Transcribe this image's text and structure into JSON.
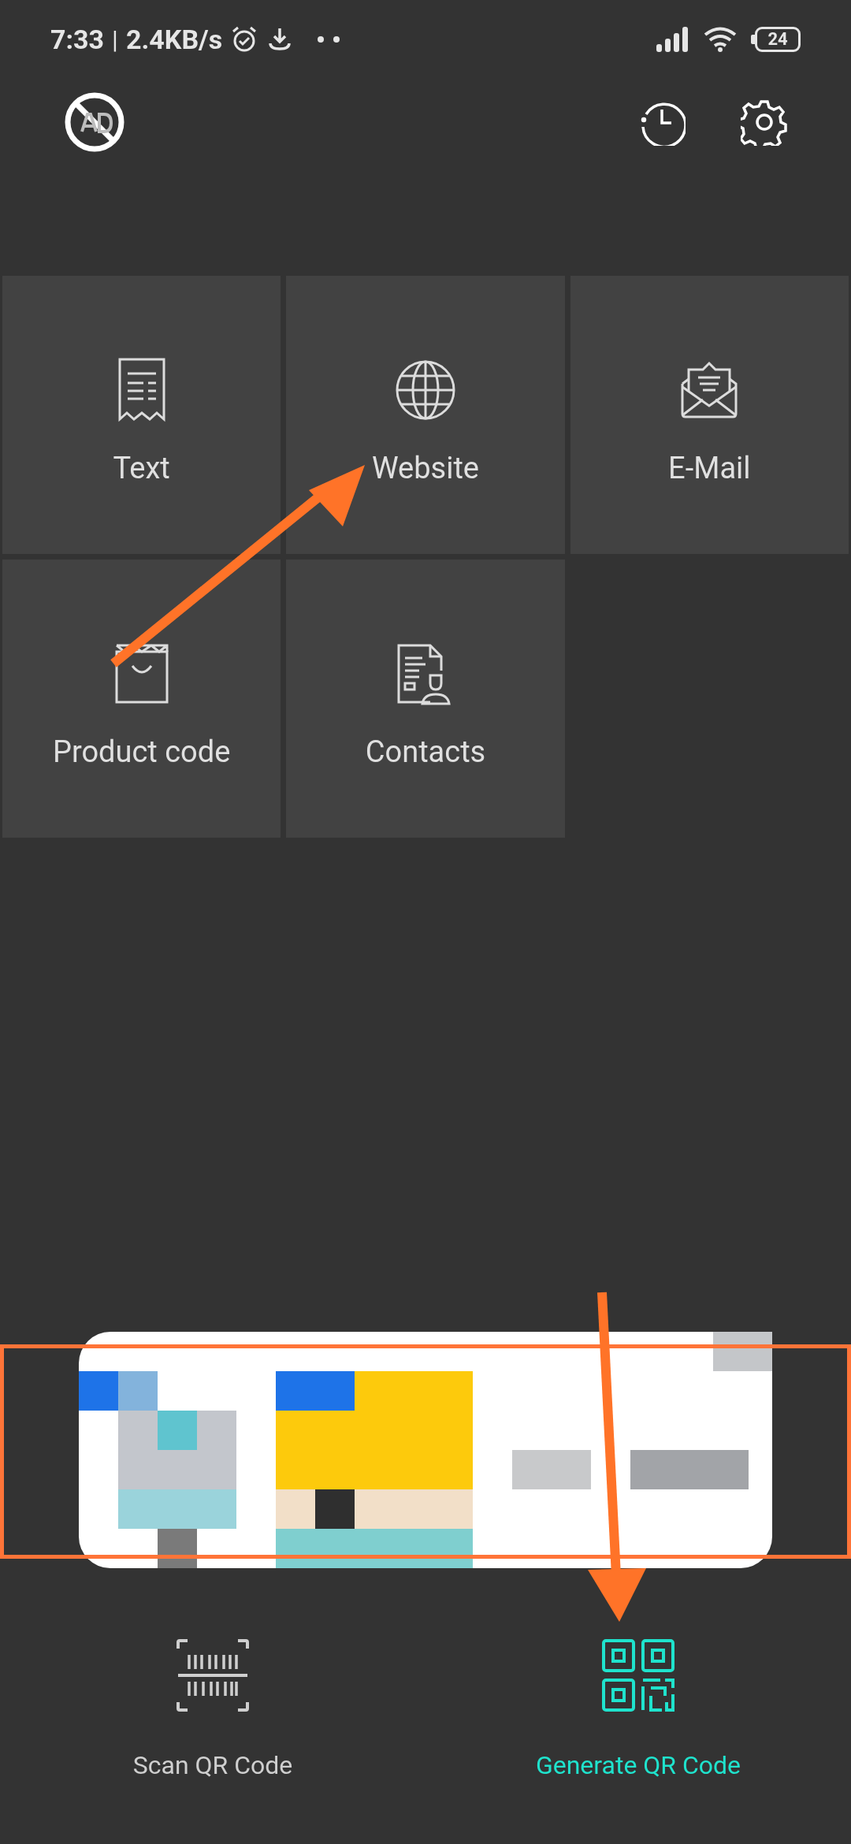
{
  "status_bar": {
    "time": "7:33",
    "separator": "|",
    "speed": "2.4KB/s",
    "battery": "24"
  },
  "tiles": [
    {
      "kind": "text",
      "label": "Text"
    },
    {
      "kind": "website",
      "label": "Website"
    },
    {
      "kind": "email",
      "label": "E-Mail"
    },
    {
      "kind": "product",
      "label": "Product code"
    },
    {
      "kind": "contacts",
      "label": "Contacts"
    }
  ],
  "bottom_nav": [
    {
      "kind": "scan",
      "label": "Scan QR Code",
      "selected": false
    },
    {
      "kind": "generate",
      "label": "Generate QR Code",
      "selected": true
    }
  ]
}
